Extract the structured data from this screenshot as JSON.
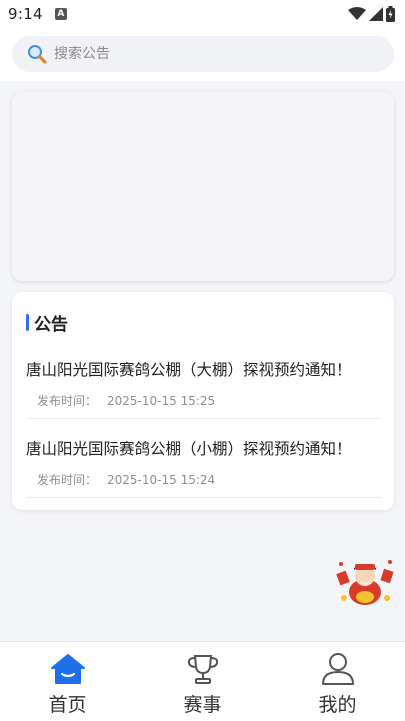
{
  "status_bar": {
    "time": "9:14",
    "notification_icon": "a-letter-icon",
    "icons": [
      "wifi-icon",
      "signal-icon",
      "battery-icon"
    ]
  },
  "search": {
    "placeholder": "搜索公告",
    "value": ""
  },
  "banner": {
    "content": ""
  },
  "notices": {
    "title": "公告",
    "accent_color": "#2f6fe0",
    "items": [
      {
        "title": "唐山阳光国际赛鸽公棚（大棚）探视预约通知！",
        "meta_label": "发布时间：",
        "meta_value": "2025-10-15 15:25"
      },
      {
        "title": "唐山阳光国际赛鸽公棚（小棚）探视预约通知！",
        "meta_label": "发布时间：",
        "meta_value": "2025-10-15 15:24"
      }
    ]
  },
  "floating": {
    "mascot_icon": "god-of-wealth-mascot-icon"
  },
  "tabbar": {
    "active_color": "#1f6fe8",
    "tabs": [
      {
        "label": "首页",
        "icon": "home-icon",
        "active": true
      },
      {
        "label": "赛事",
        "icon": "trophy-icon",
        "active": false
      },
      {
        "label": "我的",
        "icon": "user-icon",
        "active": false
      }
    ]
  }
}
